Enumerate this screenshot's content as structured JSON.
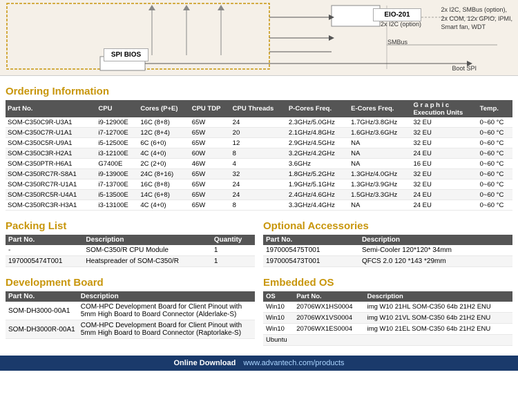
{
  "diagram": {
    "eio_label": "EIO-201",
    "spi_label": "SPI BIOS",
    "right_notes": [
      "2x I2C, SMBus (option),",
      "2x COM, 12x GPIO, IPMI,",
      "Smart fan, WDT"
    ],
    "line1": "2x I2C (option)",
    "line2": "SMBus",
    "line3": "Boot SPI"
  },
  "ordering": {
    "title": "Ordering Information",
    "columns": [
      "Part No.",
      "CPU",
      "Cores (P+E)",
      "CPU TDP",
      "CPU Threads",
      "P-Cores Freq.",
      "E-Cores Freq.",
      "Graphic Execution Units",
      "Temp."
    ],
    "rows": [
      [
        "SOM-C350C9R-U3A1",
        "i9-12900E",
        "16C (8+8)",
        "65W",
        "24",
        "2.3GHz/5.0GHz",
        "1.7GHz/3.8GHz",
        "32 EU",
        "0~60 °C"
      ],
      [
        "SOM-C350C7R-U1A1",
        "i7-12700E",
        "12C (8+4)",
        "65W",
        "20",
        "2.1GHz/4.8GHz",
        "1.6GHz/3.6GHz",
        "32 EU",
        "0~60 °C"
      ],
      [
        "SOM-C350C5R-U9A1",
        "i5-12500E",
        "6C (6+0)",
        "65W",
        "12",
        "2.9GHz/4.5GHz",
        "NA",
        "32 EU",
        "0~60 °C"
      ],
      [
        "SOM-C350C3R-H2A1",
        "i3-12100E",
        "4C (4+0)",
        "60W",
        "8",
        "3.2GHz/4.2GHz",
        "NA",
        "24 EU",
        "0~60 °C"
      ],
      [
        "SOM-C350PTR-H6A1",
        "G7400E",
        "2C (2+0)",
        "46W",
        "4",
        "3.6GHz",
        "NA",
        "16 EU",
        "0~60 °C"
      ],
      [
        "SOM-C350RC7R-S8A1",
        "i9-13900E",
        "24C (8+16)",
        "65W",
        "32",
        "1.8GHz/5.2GHz",
        "1.3GHz/4.0GHz",
        "32 EU",
        "0~60 °C"
      ],
      [
        "SOM-C350RC7R-U1A1",
        "i7-13700E",
        "16C (8+8)",
        "65W",
        "24",
        "1.9GHz/5.1GHz",
        "1.3GHz/3.9GHz",
        "32 EU",
        "0~60 °C"
      ],
      [
        "SOM-C350RC5R-U4A1",
        "i5-13500E",
        "14C (6+8)",
        "65W",
        "24",
        "2.4GHz/4.6GHz",
        "1.5GHz/3.3GHz",
        "24 EU",
        "0~60 °C"
      ],
      [
        "SOM-C350RC3R-H3A1",
        "i3-13100E",
        "4C (4+0)",
        "65W",
        "8",
        "3.3GHz/4.4GHz",
        "NA",
        "24 EU",
        "0~60 °C"
      ]
    ]
  },
  "packing": {
    "title": "Packing List",
    "columns": [
      "Part No.",
      "Description",
      "Quantity"
    ],
    "rows": [
      [
        "-",
        "SOM-C350/R CPU Module",
        "1"
      ],
      [
        "1970005474T001",
        "Heatspreader of SOM-C350/R",
        "1"
      ]
    ]
  },
  "optional": {
    "title": "Optional Accessories",
    "columns": [
      "Part No.",
      "Description"
    ],
    "rows": [
      [
        "1970005475T001",
        "Semi-Cooler 120*120* 34mm"
      ],
      [
        "1970005473T001",
        "QFCS 2.0 120 *143 *29mm"
      ]
    ]
  },
  "devboard": {
    "title": "Development Board",
    "columns": [
      "Part No.",
      "Description"
    ],
    "rows": [
      [
        "SOM-DH3000-00A1",
        "COM-HPC Development Board for Client Pinout with 5mm High Board to Board Connector (Alderlake-S)"
      ],
      [
        "SOM-DH3000R-00A1",
        "COM-HPC Development Board for Client Pinout with 5mm High Board to Board Connector (Raptorlake-S)"
      ]
    ]
  },
  "embedded": {
    "title": "Embedded OS",
    "columns": [
      "OS",
      "Part No.",
      "Description"
    ],
    "rows": [
      [
        "Win10",
        "20706WX1HS0004",
        "img W10 21HL SOM-C350 64b 21H2 ENU"
      ],
      [
        "Win10",
        "20706WX1VS0004",
        "img W10 21VL SOM-C350 64b 21H2 ENU"
      ],
      [
        "Win10",
        "20706WX1ES0004",
        "img W10 21EL SOM-C350 64b 21H2 ENU"
      ],
      [
        "Ubuntu",
        "",
        ""
      ]
    ]
  },
  "footer": {
    "label": "Online Download",
    "url": "www.advantech.com/products"
  }
}
